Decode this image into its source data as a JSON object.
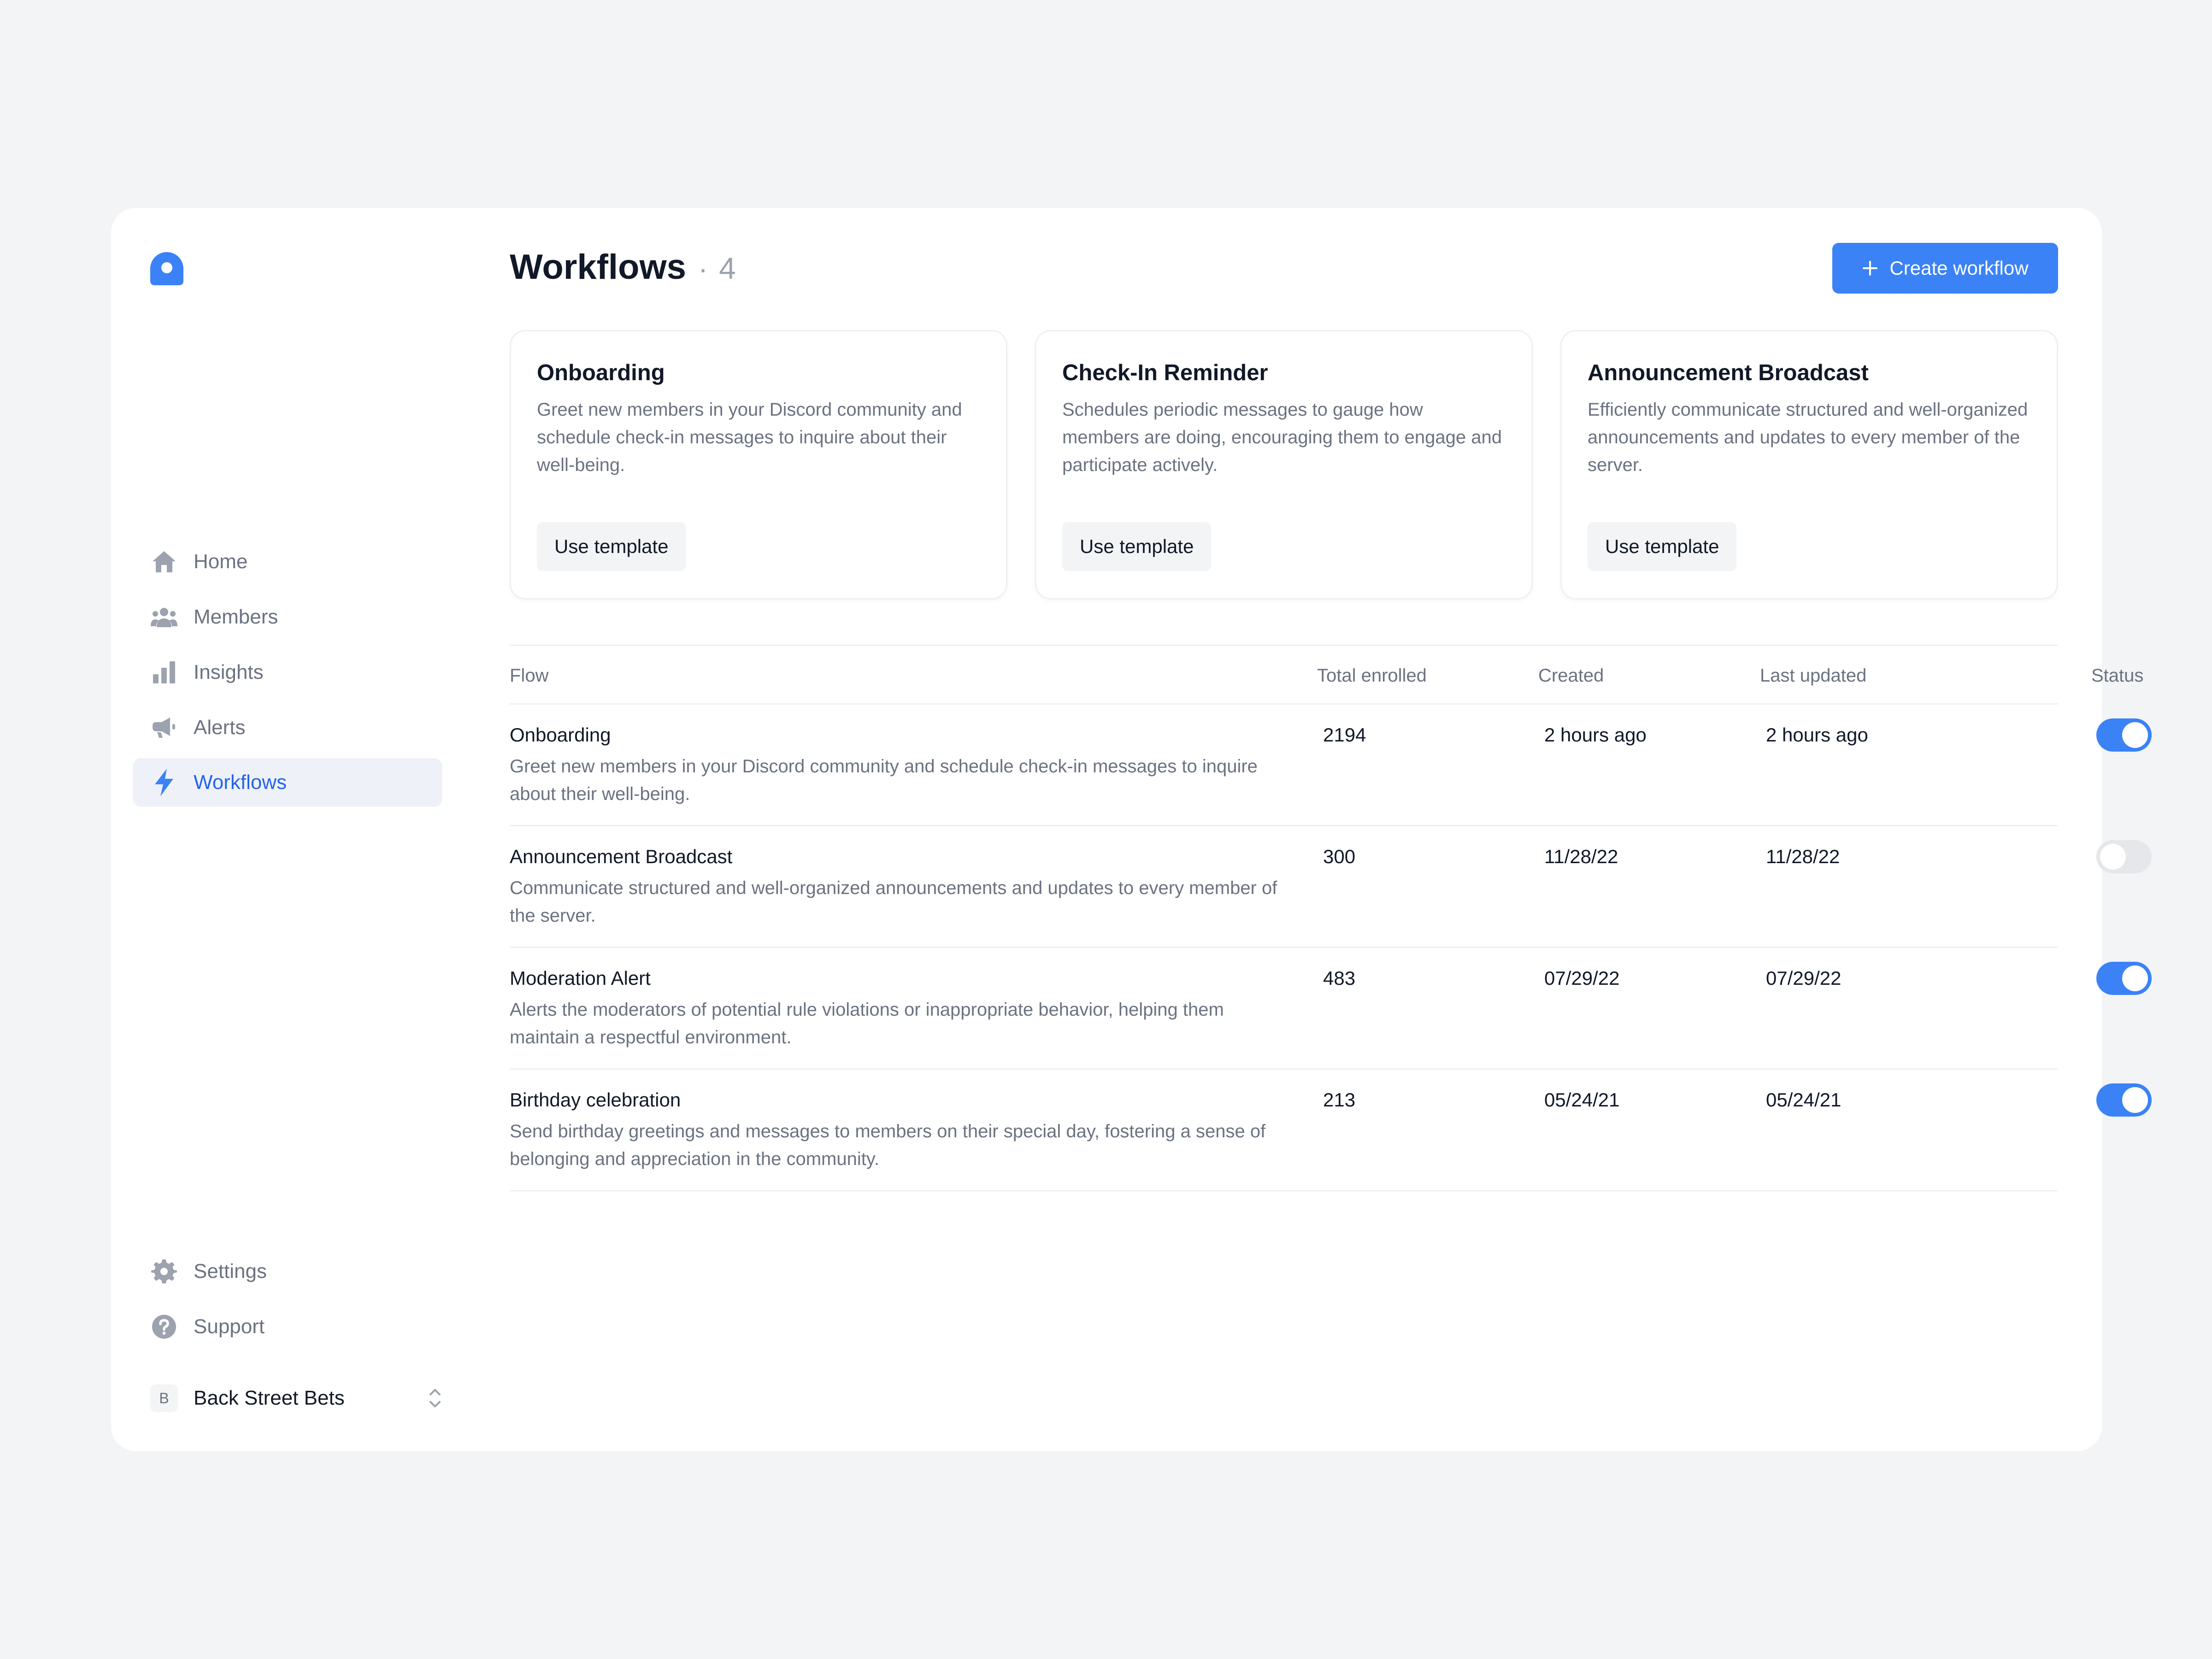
{
  "sidebar": {
    "nav": [
      {
        "label": "Home",
        "icon": "home-icon"
      },
      {
        "label": "Members",
        "icon": "users-icon"
      },
      {
        "label": "Insights",
        "icon": "bar-chart-icon"
      },
      {
        "label": "Alerts",
        "icon": "megaphone-icon"
      },
      {
        "label": "Workflows",
        "icon": "lightning-icon",
        "active": true
      }
    ],
    "bottom": [
      {
        "label": "Settings",
        "icon": "gear-icon"
      },
      {
        "label": "Support",
        "icon": "question-icon"
      }
    ],
    "workspace": {
      "initial": "B",
      "name": "Back Street Bets"
    }
  },
  "header": {
    "title": "Workflows",
    "separator": "·",
    "count": "4",
    "create_label": "Create workflow"
  },
  "templates": [
    {
      "title": "Onboarding",
      "description": "Greet new members in your Discord community and schedule check-in messages to inquire about their well-being.",
      "button": "Use template"
    },
    {
      "title": "Check-In Reminder",
      "description": "Schedules periodic messages to gauge how members are doing, encouraging them to engage and participate actively.",
      "button": "Use template"
    },
    {
      "title": "Announcement Broadcast",
      "description": "Efficiently communicate structured and well-organized announcements and updates to every member of the server.",
      "button": "Use template"
    }
  ],
  "table": {
    "headers": {
      "flow": "Flow",
      "enrolled": "Total enrolled",
      "created": "Created",
      "updated": "Last updated",
      "status": "Status"
    },
    "rows": [
      {
        "name": "Onboarding",
        "description": "Greet new members in your Discord community and schedule check-in messages to inquire about their well-being.",
        "enrolled": "2194",
        "created": "2 hours ago",
        "updated": "2 hours ago",
        "enabled": true
      },
      {
        "name": "Announcement Broadcast",
        "description": "Communicate structured and well-organized announcements and updates to every member of the server.",
        "enrolled": "300",
        "created": "11/28/22",
        "updated": "11/28/22",
        "enabled": false
      },
      {
        "name": "Moderation Alert",
        "description": "Alerts the moderators of potential rule violations or inappropriate behavior, helping them maintain a respectful environment.",
        "enrolled": "483",
        "created": "07/29/22",
        "updated": "07/29/22",
        "enabled": true
      },
      {
        "name": "Birthday celebration",
        "description": "Send birthday greetings and messages to members on their special day, fostering a sense of belonging and appreciation in the community.",
        "enrolled": "213",
        "created": "05/24/21",
        "updated": "05/24/21",
        "enabled": true
      }
    ]
  },
  "colors": {
    "accent": "#3b82f6",
    "active_text": "#2563eb",
    "active_bg": "#eef2f8",
    "muted": "#6b7280",
    "icon": "#9ca3af"
  }
}
